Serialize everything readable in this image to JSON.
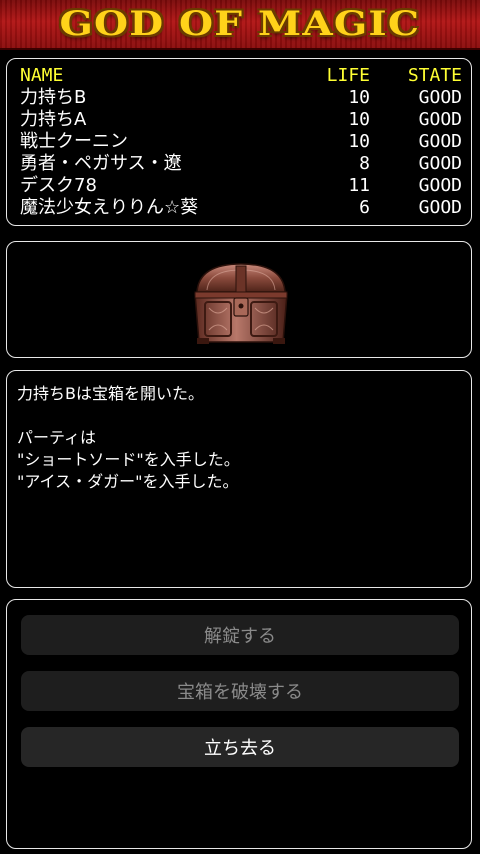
{
  "title": "GOD OF MAGIC",
  "party": {
    "headers": {
      "name": "NAME",
      "life": "LIFE",
      "state": "STATE"
    },
    "members": [
      {
        "name": "力持ちB",
        "life": "10",
        "state": "GOOD"
      },
      {
        "name": "力持ちA",
        "life": "10",
        "state": "GOOD"
      },
      {
        "name": "戦士クーニン",
        "life": "10",
        "state": "GOOD"
      },
      {
        "name": "勇者・ペガサス・遼",
        "life": "8",
        "state": "GOOD"
      },
      {
        "name": "デスク78",
        "life": "11",
        "state": "GOOD"
      },
      {
        "name": "魔法少女えりりん☆葵",
        "life": "6",
        "state": "GOOD"
      }
    ]
  },
  "message": {
    "lines": [
      "力持ちBは宝箱を開いた。",
      "",
      "パーティは",
      "\"ショートソード\"を入手した。",
      "\"アイス・ダガー\"を入手した。"
    ]
  },
  "actions": {
    "unlock": "解錠する",
    "destroy": "宝箱を破壊する",
    "leave": "立ち去る"
  },
  "colors": {
    "header_text": "#ffff33",
    "title_text": "#ffd21a",
    "title_background": "#b21515"
  }
}
